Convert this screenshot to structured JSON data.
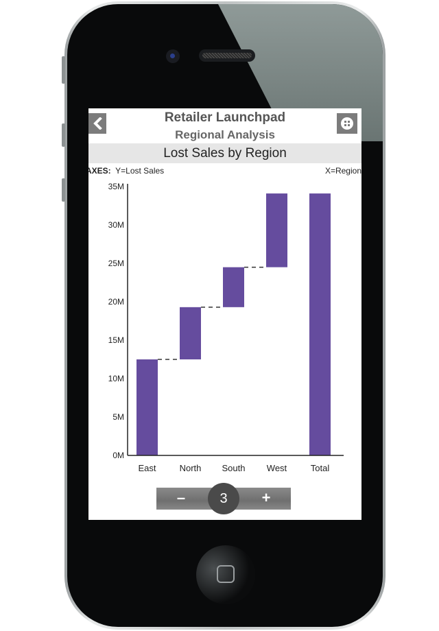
{
  "app": {
    "title": "Retailer Launchpad",
    "subtitle": "Regional Analysis"
  },
  "header": {
    "back_icon": "chevron-left-icon",
    "menu_icon": "grid-icon"
  },
  "chart_header": {
    "title": "Lost Sales by Region",
    "axes_label": "AXES:",
    "y_axis_desc": "Y=Lost Sales",
    "x_axis_desc": "X=Region"
  },
  "stepper": {
    "minus_label": "–",
    "value": "3",
    "plus_label": "+"
  },
  "colors": {
    "bar": "#654c9e",
    "connector": "#333333",
    "axis": "#222222"
  },
  "chart_data": {
    "type": "waterfall",
    "title": "Lost Sales by Region",
    "xlabel": "Region",
    "ylabel": "Lost Sales",
    "categories": [
      "East",
      "North",
      "South",
      "West",
      "Total"
    ],
    "increments": [
      12.5,
      6.8,
      5.2,
      9.6
    ],
    "values_millions": [
      12.5,
      6.8,
      5.2,
      9.6,
      34.1
    ],
    "cumulative_millions": [
      12.5,
      19.3,
      24.5,
      34.1,
      34.1
    ],
    "total_millions": 34.1,
    "ylim": [
      0,
      35
    ],
    "y_ticks": [
      "0M",
      "5M",
      "10M",
      "15M",
      "20M",
      "25M",
      "30M",
      "35M"
    ],
    "y_tick_values": [
      0,
      5,
      10,
      15,
      20,
      25,
      30,
      35
    ],
    "grid": false,
    "legend": "none",
    "connectors": "dashed"
  }
}
